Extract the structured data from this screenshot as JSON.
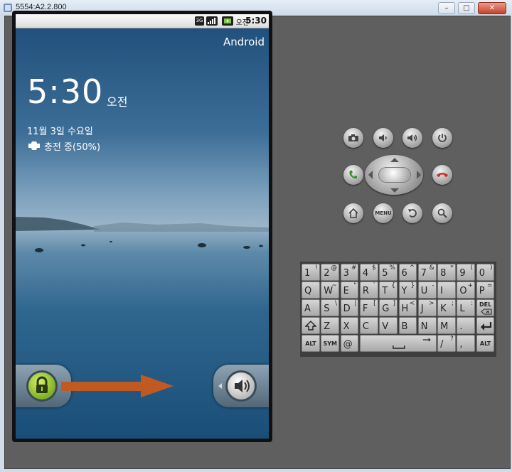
{
  "window": {
    "title": "5554:A2.2.800",
    "buttons": {
      "minimize": "–",
      "maximize": "□",
      "close": "✕"
    }
  },
  "statusbar": {
    "icons": [
      "3G",
      "signal",
      "battery"
    ],
    "ampm": "오전",
    "time": "5:30"
  },
  "lockscreen": {
    "carrier": "Android",
    "time": "5:30",
    "ampm": "오전",
    "date": "11월 3일 수요일",
    "charging": "충전 중(50%)"
  },
  "controls": {
    "row1": [
      "camera-icon",
      "volume-down-icon",
      "volume-up-icon",
      "power-icon"
    ],
    "row2": [
      "call-icon",
      "dpad",
      "end-call-icon"
    ],
    "row3": [
      "home-icon",
      "MENU",
      "back-icon",
      "search-icon"
    ]
  },
  "keyboard": {
    "row1": [
      [
        "1",
        "!"
      ],
      [
        "2",
        "@"
      ],
      [
        "3",
        "#"
      ],
      [
        "4",
        "$"
      ],
      [
        "5",
        "%"
      ],
      [
        "6",
        "^"
      ],
      [
        "7",
        "&"
      ],
      [
        "8",
        "*"
      ],
      [
        "9",
        "("
      ],
      [
        "0",
        ")"
      ]
    ],
    "row2": [
      [
        "Q",
        ""
      ],
      [
        "W",
        "~"
      ],
      [
        "E",
        "\""
      ],
      [
        "R",
        "`"
      ],
      [
        "T",
        "{"
      ],
      [
        "Y",
        "}"
      ],
      [
        "U",
        "-"
      ],
      [
        "I",
        ""
      ],
      [
        "O",
        "+"
      ],
      [
        "P",
        "="
      ]
    ],
    "row3": [
      [
        "A",
        ""
      ],
      [
        "S",
        "\\"
      ],
      [
        "D",
        "|"
      ],
      [
        "F",
        "["
      ],
      [
        "G",
        "]"
      ],
      [
        "H",
        "<"
      ],
      [
        "J",
        ">"
      ],
      [
        "K",
        ";"
      ],
      [
        "L",
        ":"
      ],
      [
        "DEL",
        ""
      ]
    ],
    "row4": [
      [
        "shift",
        ""
      ],
      [
        "Z",
        ""
      ],
      [
        "X",
        ""
      ],
      [
        "C",
        ""
      ],
      [
        "V",
        ""
      ],
      [
        "B",
        ""
      ],
      [
        "N",
        ""
      ],
      [
        "M",
        ""
      ],
      [
        ".",
        ""
      ],
      [
        "enter",
        ""
      ]
    ],
    "row5": [
      [
        "ALT",
        ""
      ],
      [
        "SYM",
        ""
      ],
      [
        "@",
        ""
      ],
      [
        "space",
        ""
      ],
      [
        "/",
        "?"
      ],
      [
        ",",
        ""
      ],
      [
        "ALT",
        ""
      ]
    ]
  }
}
